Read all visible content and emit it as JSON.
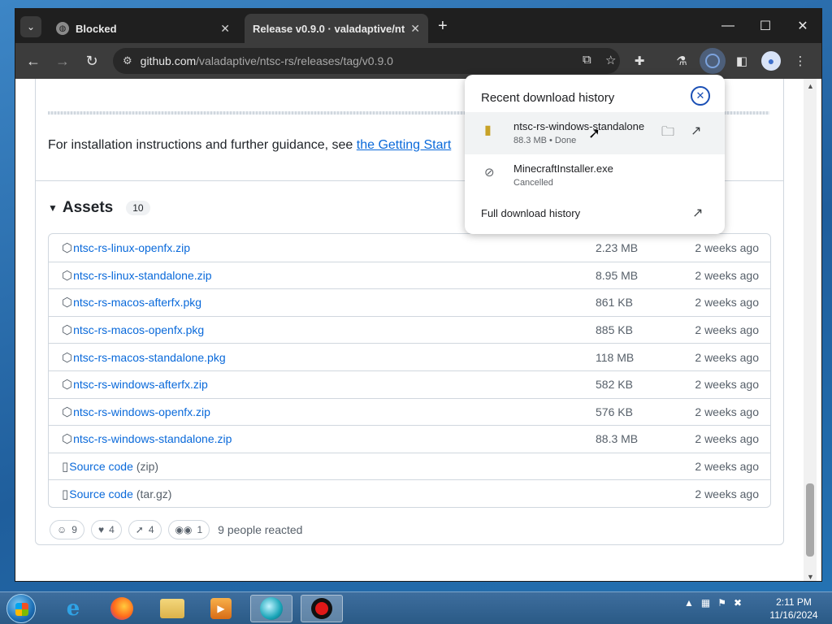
{
  "browser": {
    "tabs": [
      {
        "title": "Blocked",
        "active": false
      },
      {
        "title": "Release v0.9.0 · valadaptive/nt",
        "active": true
      }
    ],
    "url_host": "github.com",
    "url_path": "/valadaptive/ntsc-rs/releases/tag/v0.9.0"
  },
  "page": {
    "install_text": "For installation instructions and further guidance, see ",
    "install_link": "the Getting Start",
    "assets_title": "Assets",
    "assets_count": "10",
    "assets": [
      {
        "name": "ntsc-rs-linux-openfx.zip",
        "size": "2.23 MB",
        "time": "2 weeks ago"
      },
      {
        "name": "ntsc-rs-linux-standalone.zip",
        "size": "8.95 MB",
        "time": "2 weeks ago"
      },
      {
        "name": "ntsc-rs-macos-afterfx.pkg",
        "size": "861 KB",
        "time": "2 weeks ago"
      },
      {
        "name": "ntsc-rs-macos-openfx.pkg",
        "size": "885 KB",
        "time": "2 weeks ago"
      },
      {
        "name": "ntsc-rs-macos-standalone.pkg",
        "size": "118 MB",
        "time": "2 weeks ago"
      },
      {
        "name": "ntsc-rs-windows-afterfx.zip",
        "size": "582 KB",
        "time": "2 weeks ago"
      },
      {
        "name": "ntsc-rs-windows-openfx.zip",
        "size": "576 KB",
        "time": "2 weeks ago"
      },
      {
        "name": "ntsc-rs-windows-standalone.zip",
        "size": "88.3 MB",
        "time": "2 weeks ago"
      }
    ],
    "source_zip": {
      "name": "Source code",
      "fmt": "(zip)",
      "time": "2 weeks ago"
    },
    "source_tar": {
      "name": "Source code",
      "fmt": "(tar.gz)",
      "time": "2 weeks ago"
    },
    "reactions": [
      {
        "icon": "laugh-icon",
        "count": "9"
      },
      {
        "icon": "heart-icon",
        "count": "4"
      },
      {
        "icon": "rocket-icon",
        "count": "4"
      },
      {
        "icon": "eyes-icon",
        "count": "1"
      }
    ],
    "reacted_text": "9 people reacted"
  },
  "downloads": {
    "title": "Recent download history",
    "items": [
      {
        "name": "ntsc-rs-windows-standalone",
        "meta": "88.3 MB • Done"
      },
      {
        "name": "MinecraftInstaller.exe",
        "meta": "Cancelled"
      }
    ],
    "full_history": "Full download history"
  },
  "taskbar": {
    "time": "2:11 PM",
    "date": "11/16/2024"
  }
}
